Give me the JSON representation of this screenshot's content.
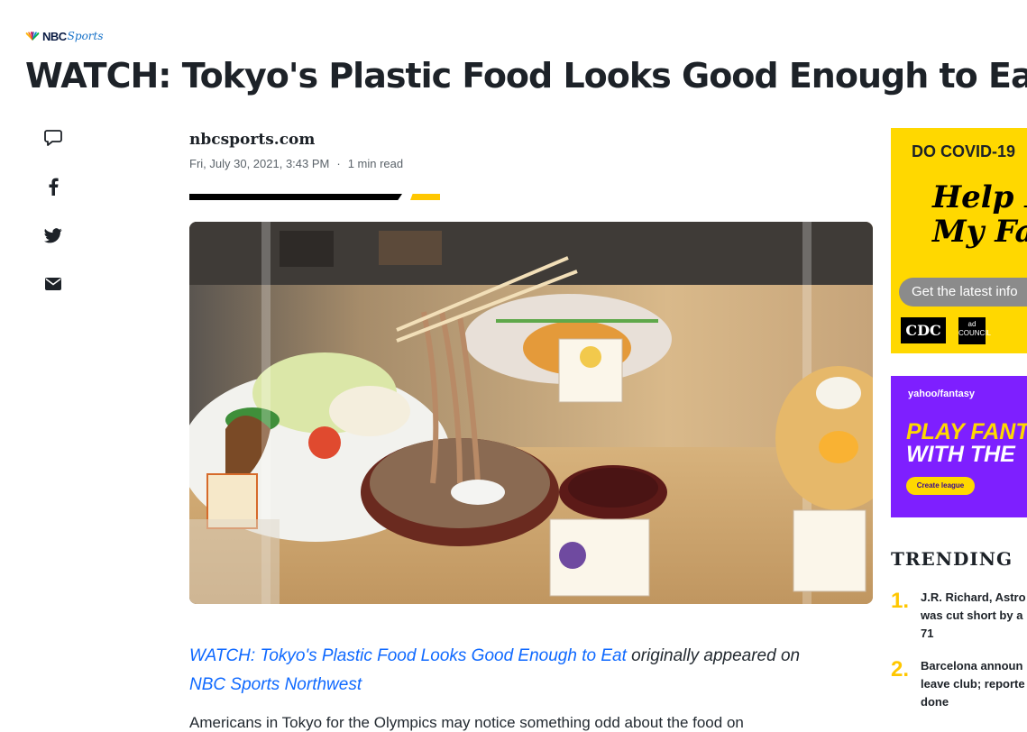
{
  "header": {
    "logo_text": "NBC",
    "logo_sub": "Sports"
  },
  "article": {
    "title": "WATCH: Tokyo's Plastic Food Looks Good Enough to Eat",
    "source": "nbcsports.com",
    "date": "Fri, July 30, 2021, 3:43 PM",
    "read_time": "1 min read",
    "caption_link": "WATCH: Tokyo's Plastic Food Looks Good Enough to Eat",
    "caption_mid": " originally appeared on ",
    "caption_source_link": "NBC Sports Northwest",
    "body_first_line": "Americans in Tokyo for the Olympics may notice something odd about the food on"
  },
  "share": {
    "icons": [
      "comment-icon",
      "facebook-icon",
      "twitter-icon",
      "email-icon"
    ]
  },
  "ads": {
    "ad1": {
      "headline": "DO COVID-19",
      "script": "Help P\nMy Fa",
      "cta": "Get the latest info",
      "logo1": "CDC",
      "logo2": "ad COUNCIL"
    },
    "ad2": {
      "brand": "yahoo/fantasy",
      "line1": "PLAY FANT",
      "line2": "WITH THE",
      "button": "Create league"
    }
  },
  "trending": {
    "heading": "TRENDING",
    "items": [
      {
        "num": "1.",
        "text": "J.R. Richard, Astro\nwas cut short by a\n71"
      },
      {
        "num": "2.",
        "text": "Barcelona announ\nleave club; reporte\ndone"
      }
    ]
  },
  "colors": {
    "accent": "#ffc700",
    "link": "#0f69ff",
    "ad_yellow": "#ffd800",
    "ad_purple": "#7e1fff"
  }
}
